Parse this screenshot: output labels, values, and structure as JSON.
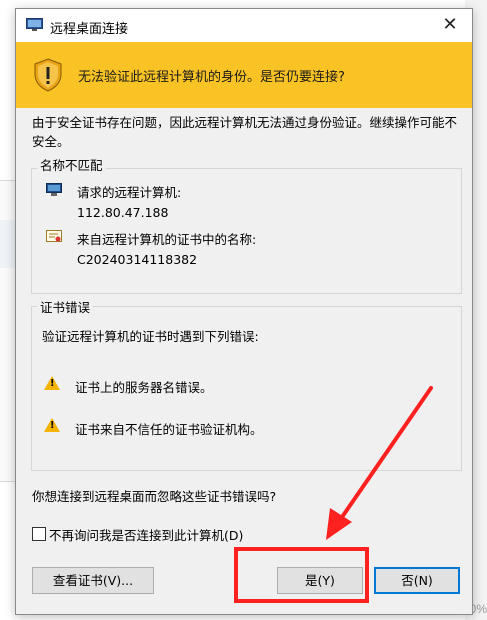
{
  "window": {
    "title": "远程桌面连接",
    "close_glyph": "✕"
  },
  "warning": {
    "message": "无法验证此远程计算机的身份。是否仍要连接?"
  },
  "intro": "由于安全证书存在问题，因此远程计算机无法通过身份验证。继续操作可能不安全。",
  "name_mismatch": {
    "heading": "名称不匹配",
    "requested_label": "请求的远程计算机:",
    "requested_value": "112.80.47.188",
    "cert_name_label": "来自远程计算机的证书中的名称:",
    "cert_name_value": "C20240314118382"
  },
  "cert_errors": {
    "heading": "证书错误",
    "description": "验证远程计算机的证书时遇到下列错误:",
    "items": [
      "证书上的服务器名错误。",
      "证书来自不信任的证书验证机构。"
    ]
  },
  "question": "你想连接到远程桌面而忽略这些证书错误吗?",
  "checkbox": {
    "label": "不再询问我是否连接到此计算机(D)",
    "checked": false
  },
  "buttons": {
    "view_cert": "查看证书(V)...",
    "yes": "是(Y)",
    "no": "否(N)"
  },
  "background": {
    "zoom_fragment": "0%"
  },
  "colors": {
    "banner": "#f9c325",
    "annotation": "#ff2020",
    "focus": "#0078d7"
  }
}
